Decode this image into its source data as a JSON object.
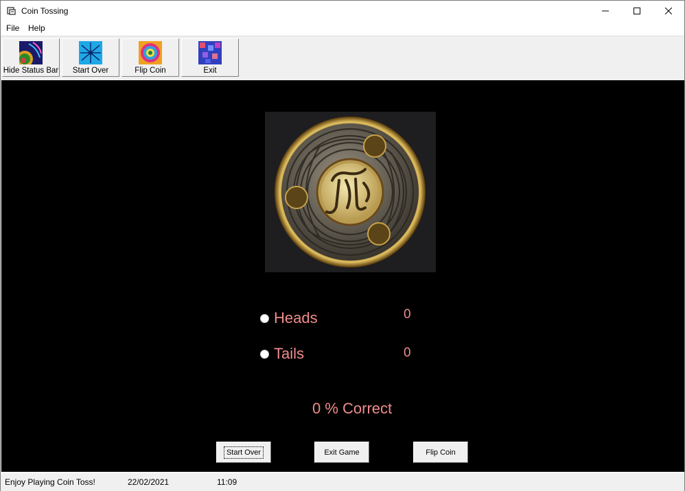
{
  "window": {
    "title": "Coin Tossing"
  },
  "menu": {
    "file": "File",
    "help": "Help"
  },
  "toolbar": {
    "hide_status_bar": "Hide Status Bar",
    "start_over": "Start Over",
    "flip_coin": "Flip Coin",
    "exit": "Exit"
  },
  "game": {
    "heads_label": "Heads",
    "heads_count": "0",
    "tails_label": "Tails",
    "tails_count": "0",
    "percent_correct": "0 % Correct",
    "start_over_button": "Start Over",
    "exit_game_button": "Exit Game",
    "flip_coin_button": "Flip Coin"
  },
  "status": {
    "message": "Enjoy Playing Coin Toss!",
    "date": "22/02/2021",
    "time": "11:09"
  },
  "colors": {
    "canvas": "#000000",
    "score_text": "#f08c8c",
    "coin_gold": "#c9a24a"
  },
  "icons": [
    "app-icon",
    "minimize-icon",
    "maximize-icon",
    "close-icon",
    "fractal-icon",
    "spiral-icon",
    "swirl-icon",
    "mosaic-icon",
    "coin-image"
  ]
}
